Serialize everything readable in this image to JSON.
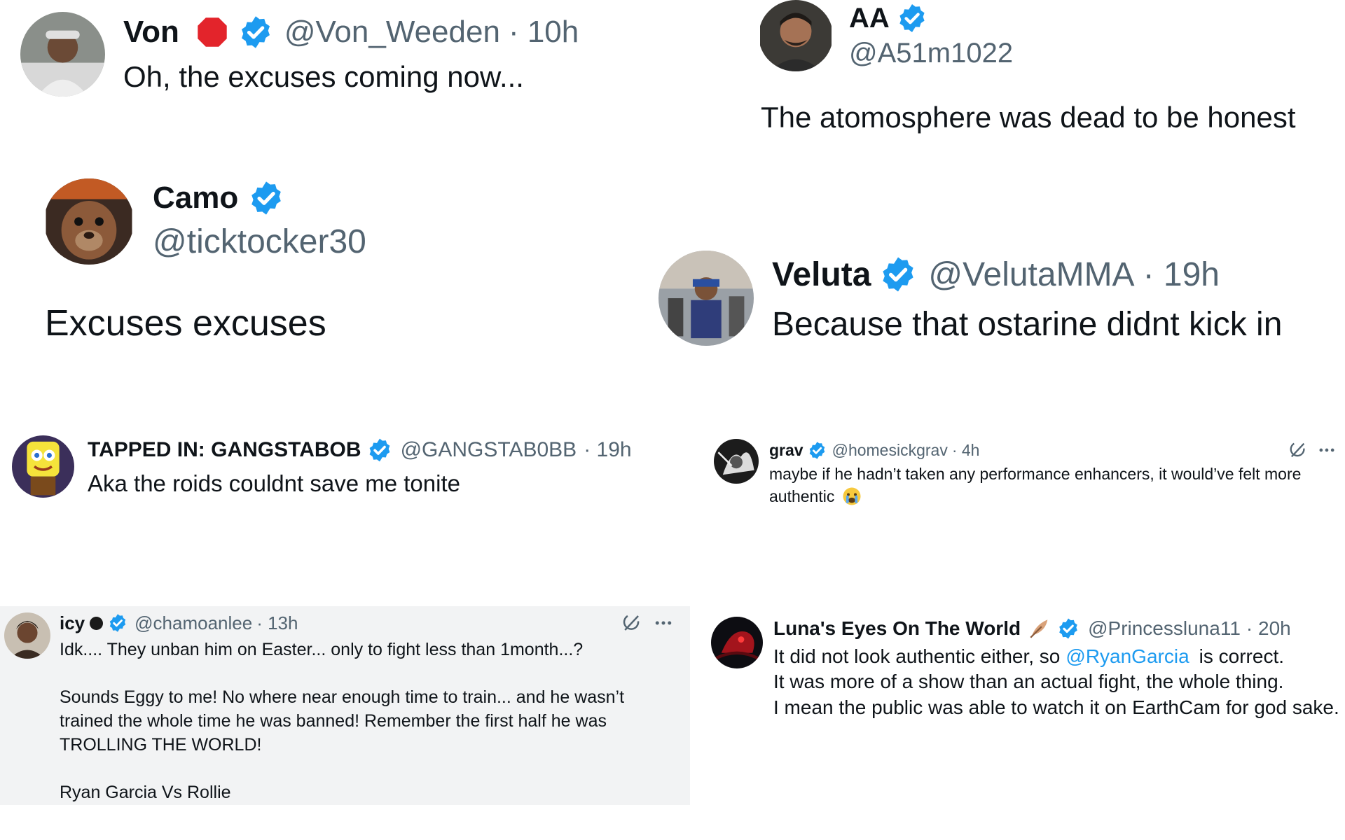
{
  "tweets": {
    "von": {
      "name": "Von",
      "handle": "@Von_Weeden",
      "time": "· 10h",
      "text": "Oh, the excuses coming now...",
      "status_emoji": "stop-sign-icon"
    },
    "aa": {
      "name": "AA",
      "handle": "@A51m1022",
      "text": "The atomosphere was dead to be honest"
    },
    "camo": {
      "name": "Camo",
      "handle": "@ticktocker30",
      "text": "Excuses excuses"
    },
    "veluta": {
      "name": "Veluta",
      "handle": "@VelutaMMA",
      "time": "· 19h",
      "text": "Because that ostarine didnt kick in"
    },
    "gangstabob": {
      "name": "TAPPED IN: GANGSTABOB",
      "handle": "@GANGSTAB0BB",
      "time": "· 19h",
      "text": "Aka the roids couldnt save me tonite"
    },
    "grav": {
      "name": "grav",
      "handle": "@homesickgrav",
      "time": "· 4h",
      "text_lines": [
        "maybe if he hadn’t taken any performance enhancers, it would’ve felt more",
        "authentic"
      ],
      "emoji": "crying-face-icon"
    },
    "icy": {
      "name": "icy",
      "handle": "@chamoanlee",
      "time": "· 13h",
      "text_lines": [
        "Idk.... They unban him on Easter... only to fight less than 1month...?",
        "",
        "Sounds Eggy to me! No where near enough time to train... and he wasn’t",
        "trained the whole time he was banned! Remember the first half he was",
        "TROLLING THE WORLD!",
        "",
        "Ryan Garcia Vs Rollie"
      ]
    },
    "luna": {
      "name": "Luna's Eyes On The World",
      "handle": "@Princessluna11",
      "time": "· 20h",
      "emoji": "feather-icon",
      "line1_before": "It did not look authentic either, so",
      "mention": "@RyanGarcia",
      "line1_after": "is correct.",
      "line2": "It was more of a show than an actual fight, the whole thing.",
      "line3": "I mean the public was able to watch it on EarthCam for god sake."
    }
  },
  "icons": {
    "verified": "verified-badge-icon",
    "grok": "grok-icon",
    "more": "more-options-icon"
  },
  "colors": {
    "verified_blue": "#1d9bf0",
    "handle_grey": "#536471",
    "text": "#0f1419",
    "card_grey": "#f2f3f4"
  }
}
